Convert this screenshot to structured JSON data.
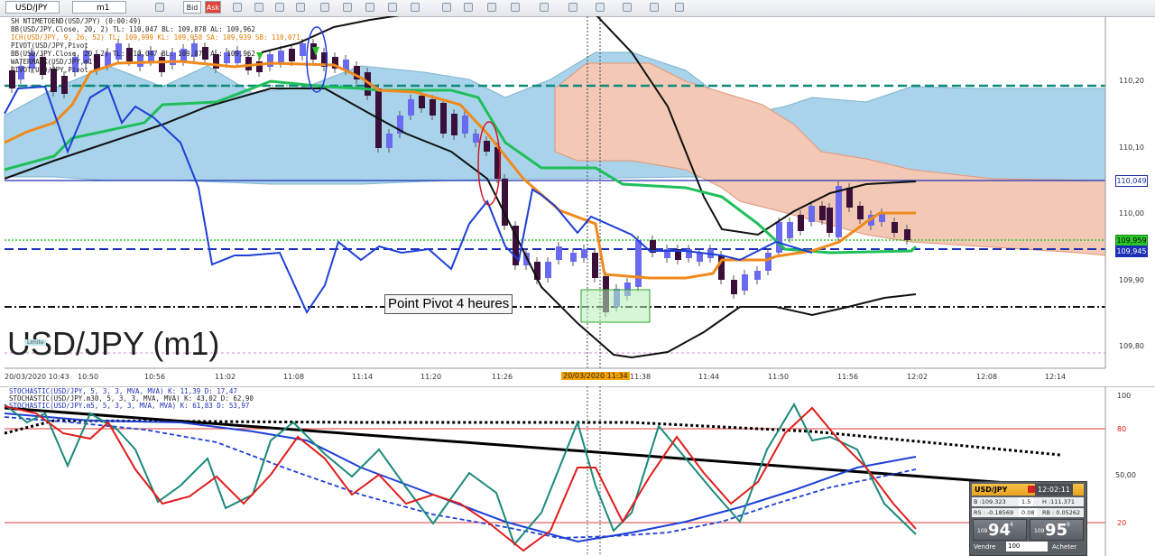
{
  "toolbar": {
    "symbol": "USD/JPY",
    "timeframe": "m1",
    "bid_label": "Bid",
    "ask_label": "Ask"
  },
  "legend_main": [
    "SH  NTIMETOEND(USD/JPY) (0:00:49)",
    "BB(USD/JPY.Close, 20, 2)  TL: 110,047  BL: 109,878  AL: 109,962",
    "ICH(USD/JPY, 9, 26, 52)  TL: 109,999  KL: 109,958  SA: 109,939  SB: 110,071",
    "PIVOT(USD/JPY,Pivot",
    "BB(USD/JPY.Close, 20, 2)  TL: 110,047  BL: 109,878  AL: 109,962",
    "WATERMARK(USD/JPY,m1)",
    "PIVOT(USD/JPY,Pivot"
  ],
  "watermark": "USD/JPY (m1)",
  "limite_label": "Limite",
  "pivot_label": "Point Pivot 4 heures",
  "x_axis": {
    "labels": [
      "20/03/2020 10:43",
      "10:50",
      "10:56",
      "11:02",
      "11:08",
      "11:14",
      "11:20",
      "11:26",
      "11:38",
      "11:44",
      "11:50",
      "11:56",
      "12:02",
      "12:08",
      "12:14"
    ],
    "cursor_label": "20/03/2020 11:34"
  },
  "y_axis": {
    "ticks": [
      "110,20",
      "110,10",
      "110,00",
      "109,90",
      "109,80"
    ],
    "badges": [
      {
        "text": "110,049",
        "bg": "#ffffff",
        "fg": "#1c2f9e",
        "border": "#1c2f9e"
      },
      {
        "text": "109,959",
        "bg": "#28c828",
        "fg": "#000000",
        "border": "#1a8a1a"
      },
      {
        "text": "109,945",
        "bg": "#1c2fb5",
        "fg": "#ffffff",
        "border": "#1c2fb5"
      }
    ]
  },
  "stoch_legend": [
    {
      "text": "STOCHASTIC(USD/JPY, 5, 3, 3, MVA, MVA)  K: 11,39  D: 17,47",
      "color": "#1c2fb5"
    },
    {
      "text": "STOCHASTIC(USD/JPY.m30, 5, 3, 3, MVA, MVA)  K: 43,02  D: 62,90",
      "color": "#222222"
    },
    {
      "text": "STOCHASTIC(USD/JPY.m5, 5, 3, 3, MVA, MVA)  K: 61,83  D: 53,97",
      "color": "#1c2fb5"
    }
  ],
  "stoch_axis": {
    "ticks": [
      "100",
      "80",
      "50,00",
      "20"
    ]
  },
  "panel": {
    "symbol": "USD/JPY",
    "time": "12:02:11",
    "row1": {
      "b": "B :109.323",
      "spread": "1.5",
      "h": "H :111.371"
    },
    "row2": {
      "rs": "RS : -0.18569",
      "mid": "0.08",
      "rb": "RB : 0.05262"
    },
    "sell": {
      "pre": "109",
      "num": "94",
      "sup": "4"
    },
    "buy": {
      "pre": "109",
      "num": "95",
      "sup": "9"
    },
    "sell_label": "Vendre",
    "qty": "100",
    "buy_label": "Acheter"
  },
  "colors": {
    "bull_candle": "#6a6af0",
    "bear_candle": "#3a0f3a",
    "orange_line": "#f08a1c",
    "green_line": "#1fbf5a",
    "blue_line": "#1e3fd6",
    "kumo_bull": "#a9d3ea",
    "kumo_bear": "#f3c9b6"
  }
}
